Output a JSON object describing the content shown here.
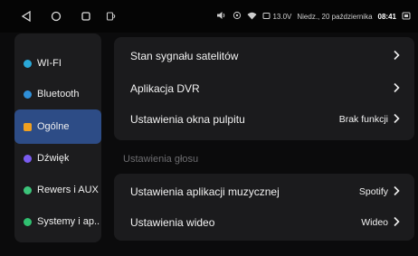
{
  "status": {
    "voltage": "13.0V",
    "date": "Niedz., 20 października",
    "time": "08:41"
  },
  "sidebar": {
    "items": [
      {
        "label": "WI-FI",
        "icon": "wifi-icon",
        "color": "#2aa8d8",
        "active": false
      },
      {
        "label": "Bluetooth",
        "icon": "bluetooth-icon",
        "color": "#2f8fd8",
        "active": false
      },
      {
        "label": "Ogólne",
        "icon": "general-icon",
        "color": "#f0a020",
        "active": true
      },
      {
        "label": "Dźwięk",
        "icon": "sound-icon",
        "color": "#7a5cf0",
        "active": false
      },
      {
        "label": "Rewers i AUX",
        "icon": "reverse-icon",
        "color": "#3cc47a",
        "active": false
      },
      {
        "label": "Systemy i ap..",
        "icon": "system-icon",
        "color": "#30c070",
        "active": false
      }
    ]
  },
  "main": {
    "rows_top": [
      {
        "label": "Stan sygnału satelitów",
        "value": ""
      },
      {
        "label": "Aplikacja DVR",
        "value": ""
      },
      {
        "label": "Ustawienia okna pulpitu",
        "value": "Brak funkcji"
      }
    ],
    "section_title": "Ustawienia głosu",
    "rows_bottom": [
      {
        "label": "Ustawienia aplikacji muzycznej",
        "value": "Spotify"
      },
      {
        "label": "Ustawienia wideo",
        "value": "Wideo"
      }
    ]
  },
  "colors": {
    "accent": "#2d4c86",
    "background": "#0b0b0c",
    "panel": "#1b1b1d"
  }
}
